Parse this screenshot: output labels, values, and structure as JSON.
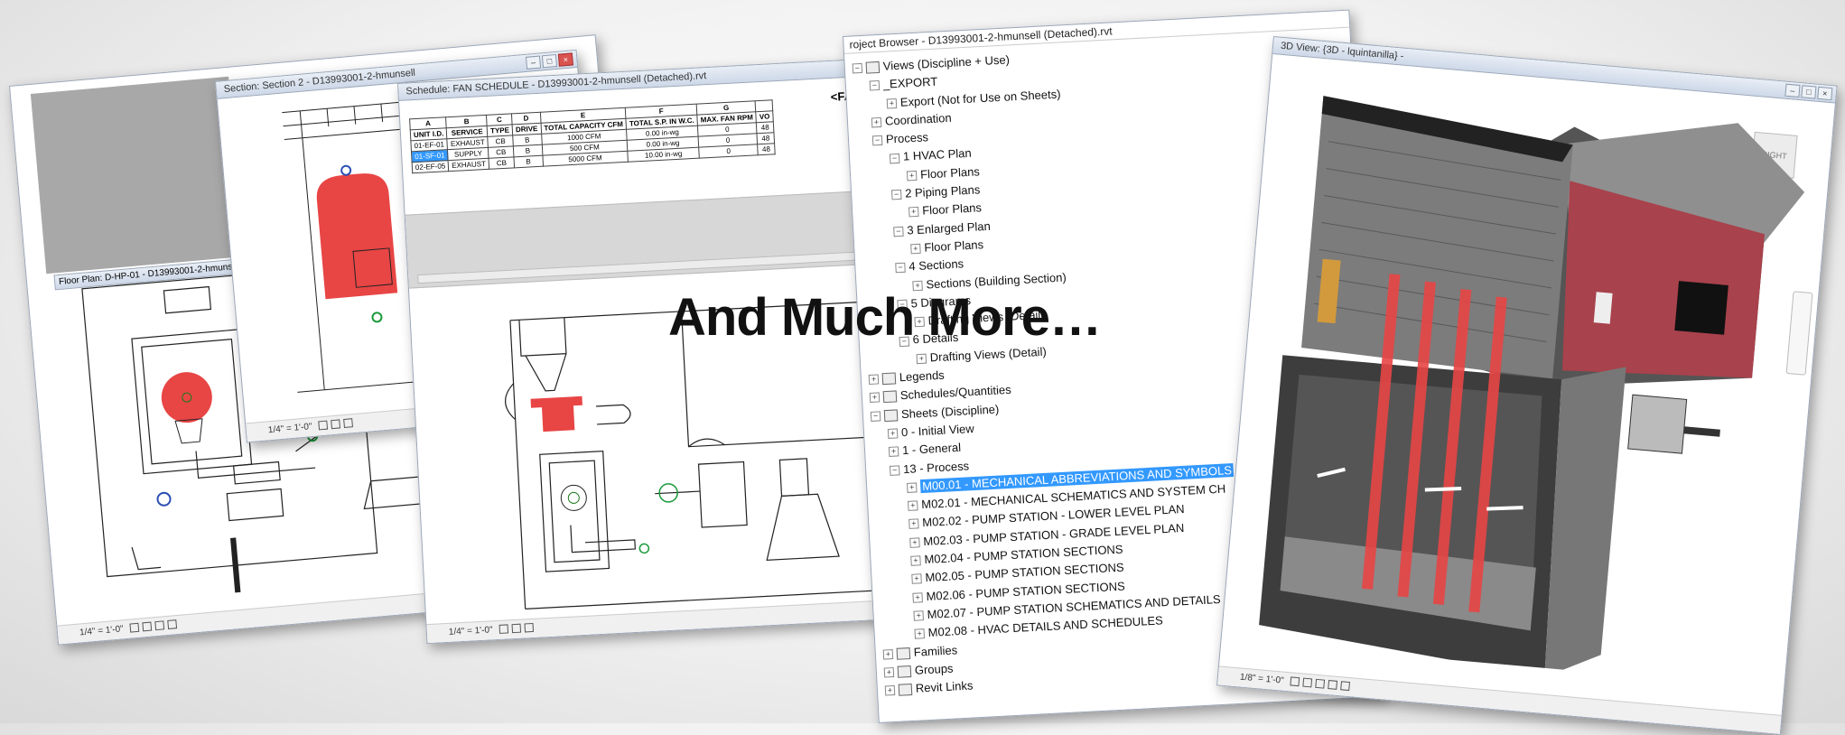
{
  "overlay_text": "And Much More…",
  "floor_plan_window": {
    "title": "Floor Plan: D-HP-01 - D13993001-2-hmunsell (De",
    "scale": "1/4\" = 1'-0\""
  },
  "section_window": {
    "title": "Section: Section 2 - D13993001-2-hmunsell",
    "scale": "1/4\" = 1'-0\""
  },
  "schedule_window": {
    "title": "Schedule: FAN SCHEDULE - D13993001-2-hmunsell (Detached).rvt",
    "schedule_title": "<FAN SCH",
    "column_letters": [
      "A",
      "B",
      "C",
      "D",
      "E",
      "F",
      "G",
      ""
    ],
    "headers": [
      "UNIT I.D.",
      "SERVICE",
      "TYPE",
      "DRIVE",
      "TOTAL CAPACITY CFM",
      "TOTAL S.P. IN W.C.",
      "MAX. FAN RPM",
      "VO"
    ],
    "rows": [
      [
        "01-EF-01",
        "EXHAUST",
        "CB",
        "B",
        "1000 CFM",
        "0.00 in-wg",
        "0",
        "48"
      ],
      [
        "01-SF-01",
        "SUPPLY",
        "CB",
        "B",
        "500 CFM",
        "0.00 in-wg",
        "0",
        "48"
      ],
      [
        "02-EF-05",
        "EXHAUST",
        "CB",
        "B",
        "5000 CFM",
        "10.00 in-wg",
        "0",
        "48"
      ]
    ],
    "scale": "1/4\" = 1'-0\""
  },
  "project_browser": {
    "title": "roject Browser - D13993001-2-hmunsell (Detached).rvt",
    "tree": [
      {
        "label": "Views (Discipline + Use)",
        "indent": 0,
        "toggle": "−",
        "icon": true
      },
      {
        "label": "_EXPORT",
        "indent": 1,
        "toggle": "−"
      },
      {
        "label": "Export (Not for Use on Sheets)",
        "indent": 2,
        "toggle": "+"
      },
      {
        "label": "Coordination",
        "indent": 1,
        "toggle": "+"
      },
      {
        "label": "Process",
        "indent": 1,
        "toggle": "−"
      },
      {
        "label": "1 HVAC Plan",
        "indent": 2,
        "toggle": "−"
      },
      {
        "label": "Floor Plans",
        "indent": 3,
        "toggle": "+"
      },
      {
        "label": "2 Piping Plans",
        "indent": 2,
        "toggle": "−"
      },
      {
        "label": "Floor Plans",
        "indent": 3,
        "toggle": "+"
      },
      {
        "label": "3 Enlarged Plan",
        "indent": 2,
        "toggle": "−"
      },
      {
        "label": "Floor Plans",
        "indent": 3,
        "toggle": "+"
      },
      {
        "label": "4 Sections",
        "indent": 2,
        "toggle": "−"
      },
      {
        "label": "Sections (Building Section)",
        "indent": 3,
        "toggle": "+"
      },
      {
        "label": "5 Diagrams",
        "indent": 2,
        "toggle": "−"
      },
      {
        "label": "Drafting Views (Detail)",
        "indent": 3,
        "toggle": "+"
      },
      {
        "label": "6 Details",
        "indent": 2,
        "toggle": "−"
      },
      {
        "label": "Drafting Views (Detail)",
        "indent": 3,
        "toggle": "+"
      },
      {
        "label": "Legends",
        "indent": 0,
        "toggle": "+",
        "icon": true
      },
      {
        "label": "Schedules/Quantities",
        "indent": 0,
        "toggle": "+",
        "icon": true
      },
      {
        "label": "Sheets (Discipline)",
        "indent": 0,
        "toggle": "−",
        "icon": true
      },
      {
        "label": "0 - Initial View",
        "indent": 1,
        "toggle": "+"
      },
      {
        "label": "1 - General",
        "indent": 1,
        "toggle": "+"
      },
      {
        "label": "13 -  Process",
        "indent": 1,
        "toggle": "−"
      },
      {
        "label": "M00.01 - MECHANICAL ABBREVIATIONS AND SYMBOLS",
        "indent": 2,
        "toggle": "+",
        "selected": true
      },
      {
        "label": "M02.01 - MECHANICAL SCHEMATICS AND SYSTEM CH",
        "indent": 2,
        "toggle": "+"
      },
      {
        "label": "M02.02 - PUMP STATION - LOWER LEVEL PLAN",
        "indent": 2,
        "toggle": "+"
      },
      {
        "label": "M02.03 - PUMP STATION - GRADE LEVEL PLAN",
        "indent": 2,
        "toggle": "+"
      },
      {
        "label": "M02.04 - PUMP STATION SECTIONS",
        "indent": 2,
        "toggle": "+"
      },
      {
        "label": "M02.05 - PUMP STATION SECTIONS",
        "indent": 2,
        "toggle": "+"
      },
      {
        "label": "M02.06 - PUMP STATION SECTIONS",
        "indent": 2,
        "toggle": "+"
      },
      {
        "label": "M02.07 - PUMP STATION SCHEMATICS AND DETAILS",
        "indent": 2,
        "toggle": "+"
      },
      {
        "label": "M02.08 - HVAC DETAILS AND SCHEDULES",
        "indent": 2,
        "toggle": "+"
      },
      {
        "label": "Families",
        "indent": 0,
        "toggle": "+",
        "icon": true
      },
      {
        "label": "Groups",
        "indent": 0,
        "toggle": "+",
        "icon": true
      },
      {
        "label": "Revit Links",
        "indent": 0,
        "toggle": "+",
        "icon": true
      }
    ]
  },
  "view3d_window": {
    "title": "3D View: {3D - lquintanilla} -",
    "scale": "1/8\" = 1'-0\"",
    "viewcube_label": "RIGHT"
  },
  "colors": {
    "selection": "#3399ff",
    "equipment_red": "#e84545",
    "building_red": "#a8424c"
  }
}
